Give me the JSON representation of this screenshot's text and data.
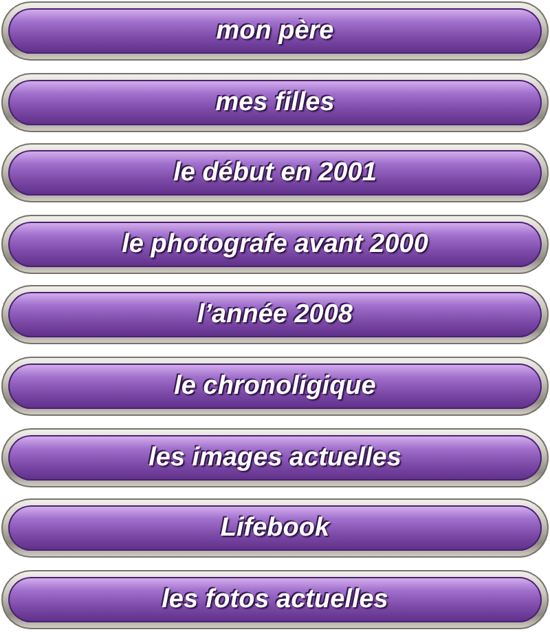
{
  "menu": [
    {
      "label": "mon père"
    },
    {
      "label": "mes filles"
    },
    {
      "label": "le début en 2001"
    },
    {
      "label": "le photografe avant 2000"
    },
    {
      "label": "l’année 2008"
    },
    {
      "label": "le chronoligique"
    },
    {
      "label": "les images actuelles"
    },
    {
      "label": "Lifebook"
    },
    {
      "label": "les fotos actuelles"
    }
  ]
}
